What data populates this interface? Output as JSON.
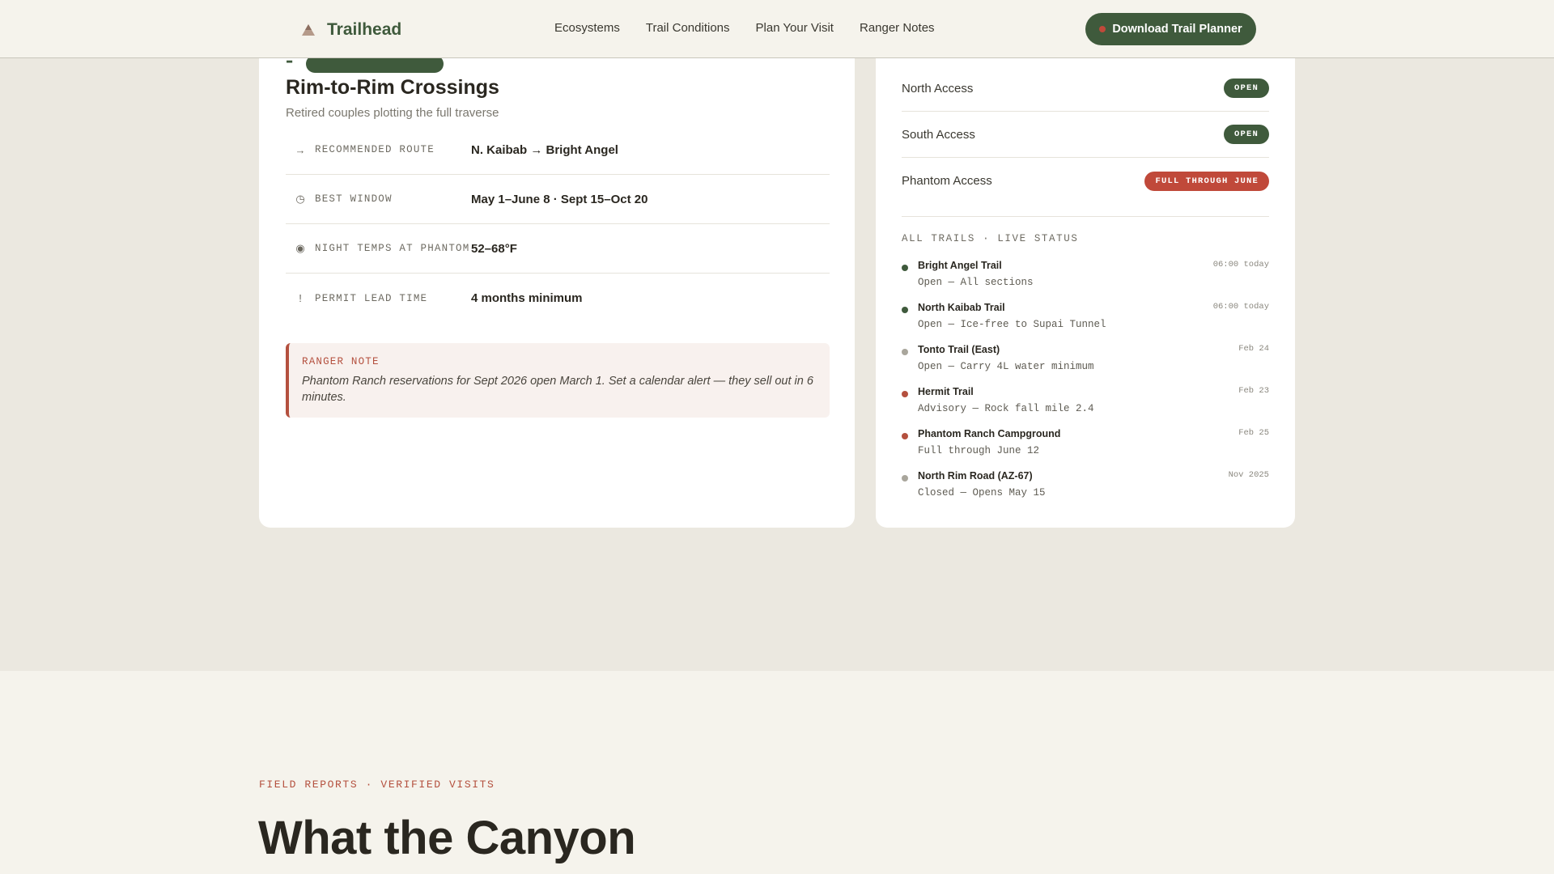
{
  "header": {
    "brand": "Trailhead",
    "nav": [
      "Ecosystems",
      "Trail Conditions",
      "Plan Your Visit",
      "Ranger Notes"
    ],
    "cta_label": "Download Trail Planner"
  },
  "profile_card": {
    "title": "Rim-to-Rim Crossings",
    "subtitle": "Retired couples plotting the full traverse",
    "rows": [
      {
        "icon": "→",
        "label": "RECOMMENDED ROUTE",
        "value": "N. Kaibab → Bright Angel"
      },
      {
        "icon": "◷",
        "label": "BEST WINDOW",
        "value": "May 1–June 8 · Sept 15–Oct 20"
      },
      {
        "icon": "◉",
        "label": "NIGHT TEMPS AT PHANTOM",
        "value": "52–68°F"
      },
      {
        "icon": "!",
        "label": "PERMIT LEAD TIME",
        "value": "4 months minimum"
      }
    ],
    "ranger_note": {
      "label": "RANGER NOTE",
      "text": "Phantom Ranch reservations for Sept 2026 open March 1. Set a calendar alert — they sell out in 6 minutes."
    }
  },
  "status_card": {
    "access": [
      {
        "name": "North Access",
        "badge": "OPEN",
        "status": "open"
      },
      {
        "name": "South Access",
        "badge": "OPEN",
        "status": "open"
      },
      {
        "name": "Phantom Access",
        "badge": "FULL THROUGH JUNE",
        "status": "full"
      }
    ],
    "trails_heading": "ALL TRAILS · LIVE STATUS",
    "trails": [
      {
        "name": "Bright Angel Trail",
        "status": "Open — All sections",
        "time": "06:00 today",
        "color": "#3f5a3c"
      },
      {
        "name": "North Kaibab Trail",
        "status": "Open — Ice-free to Supai Tunnel",
        "time": "06:00 today",
        "color": "#3f5a3c"
      },
      {
        "name": "Tonto Trail (East)",
        "status": "Open — Carry 4L water minimum",
        "time": "Feb 24",
        "color": "#a9a69c"
      },
      {
        "name": "Hermit Trail",
        "status": "Advisory — Rock fall mile 2.4",
        "time": "Feb 23",
        "color": "#b4503e"
      },
      {
        "name": "Phantom Ranch Campground",
        "status": "Full through June 12",
        "time": "Feb 25",
        "color": "#b4503e"
      },
      {
        "name": "North Rim Road (AZ-67)",
        "status": "Closed — Opens May 15",
        "time": "Nov 2025",
        "color": "#a9a69c"
      }
    ]
  },
  "reports": {
    "eyebrow": "FIELD REPORTS · VERIFIED VISITS",
    "title": "What the Canyon"
  },
  "colors": {
    "brand_green": "#3f5a3c",
    "alert_red": "#c0493a",
    "rust": "#b4503e",
    "page_bg": "#ebe8e0",
    "header_bg": "#f5f3ec"
  }
}
